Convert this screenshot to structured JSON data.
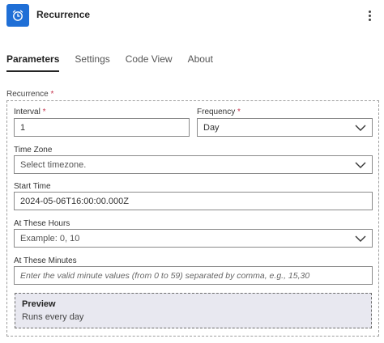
{
  "header": {
    "title": "Recurrence",
    "icon": "alarm-clock-icon",
    "accent": "#1f6fd6"
  },
  "tabs": [
    {
      "label": "Parameters",
      "active": true
    },
    {
      "label": "Settings",
      "active": false
    },
    {
      "label": "Code View",
      "active": false
    },
    {
      "label": "About",
      "active": false
    }
  ],
  "recurrence": {
    "label": "Recurrence",
    "required_mark": "*",
    "interval": {
      "label": "Interval",
      "required_mark": "*",
      "value": "1"
    },
    "frequency": {
      "label": "Frequency",
      "required_mark": "*",
      "value": "Day"
    },
    "time_zone": {
      "label": "Time Zone",
      "placeholder": "Select timezone."
    },
    "start_time": {
      "label": "Start Time",
      "value": "2024-05-06T16:00:00.000Z"
    },
    "at_these_hours": {
      "label": "At These Hours",
      "placeholder": "Example: 0, 10"
    },
    "at_these_minutes": {
      "label": "At These Minutes",
      "placeholder": "Enter the valid minute values (from 0 to 59) separated by comma, e.g., 15,30"
    },
    "preview": {
      "title": "Preview",
      "text": "Runs every day"
    }
  }
}
